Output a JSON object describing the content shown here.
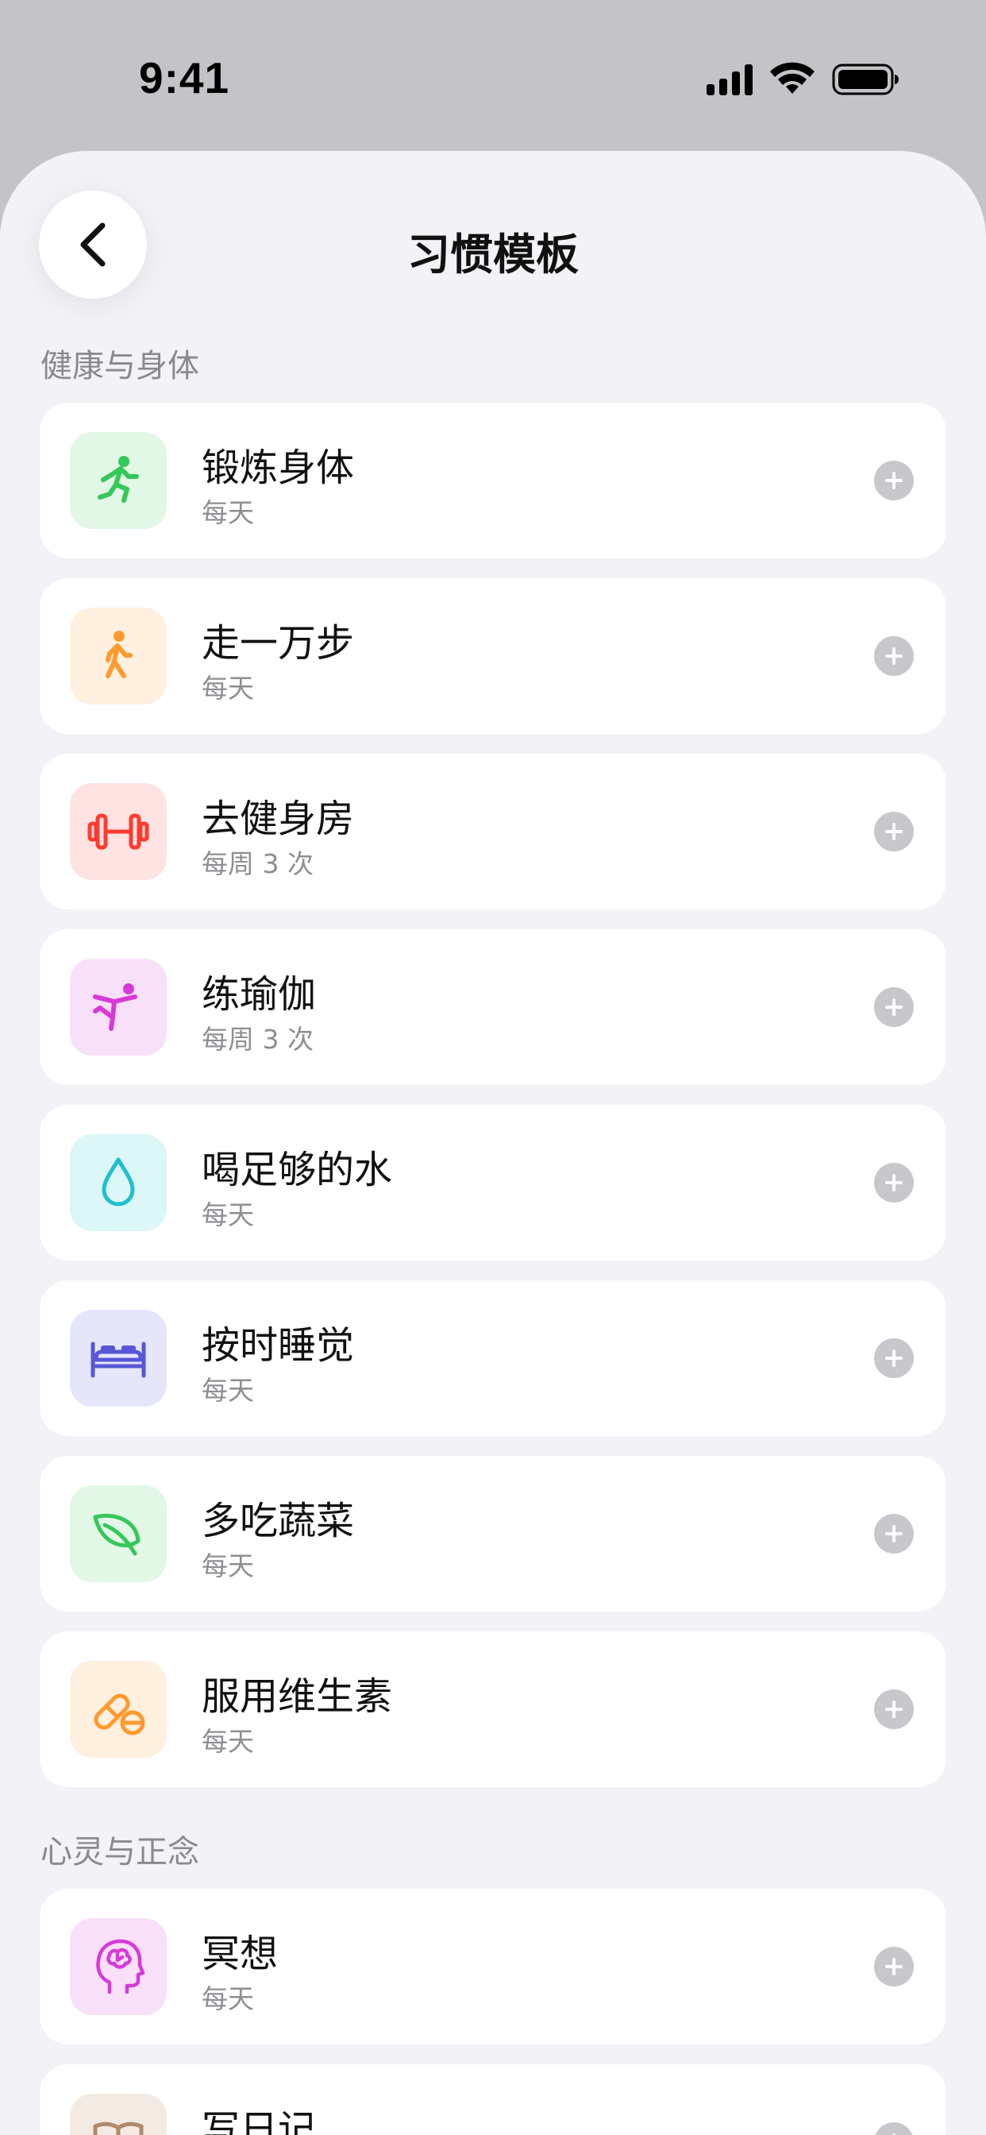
{
  "status_bar": {
    "time": "9:41"
  },
  "header": {
    "title": "习惯模板",
    "back_icon": "chevron-left-icon"
  },
  "sections": [
    {
      "title": "健康与身体",
      "items": [
        {
          "title": "锻炼身体",
          "frequency": "每天",
          "icon": "running-icon",
          "color": "#34c759",
          "tile": "#e2f7e6"
        },
        {
          "title": "走一万步",
          "frequency": "每天",
          "icon": "walking-icon",
          "color": "#ff9a2e",
          "tile": "#fff0e0"
        },
        {
          "title": "去健身房",
          "frequency": "每周 3 次",
          "icon": "dumbbell-icon",
          "color": "#ff3b30",
          "tile": "#ffe2e2"
        },
        {
          "title": "练瑜伽",
          "frequency": "每周 3 次",
          "icon": "yoga-icon",
          "color": "#d63ad8",
          "tile": "#f8e0f8"
        },
        {
          "title": "喝足够的水",
          "frequency": "每天",
          "icon": "water-drop-icon",
          "color": "#1ec0cc",
          "tile": "#ddf6f8"
        },
        {
          "title": "按时睡觉",
          "frequency": "每天",
          "icon": "bed-icon",
          "color": "#5856d6",
          "tile": "#e6e6fb"
        },
        {
          "title": "多吃蔬菜",
          "frequency": "每天",
          "icon": "leaf-icon",
          "color": "#34c759",
          "tile": "#e2f7e6"
        },
        {
          "title": "服用维生素",
          "frequency": "每天",
          "icon": "pills-icon",
          "color": "#ff9a2e",
          "tile": "#fff0e0"
        }
      ]
    },
    {
      "title": "心灵与正念",
      "items": [
        {
          "title": "冥想",
          "frequency": "每天",
          "icon": "brain-head-icon",
          "color": "#d63ad8",
          "tile": "#f8e0f8"
        },
        {
          "title": "写日记",
          "frequency": "",
          "icon": "book-icon",
          "color": "#b08a6a",
          "tile": "#f3ebe3"
        }
      ]
    }
  ]
}
